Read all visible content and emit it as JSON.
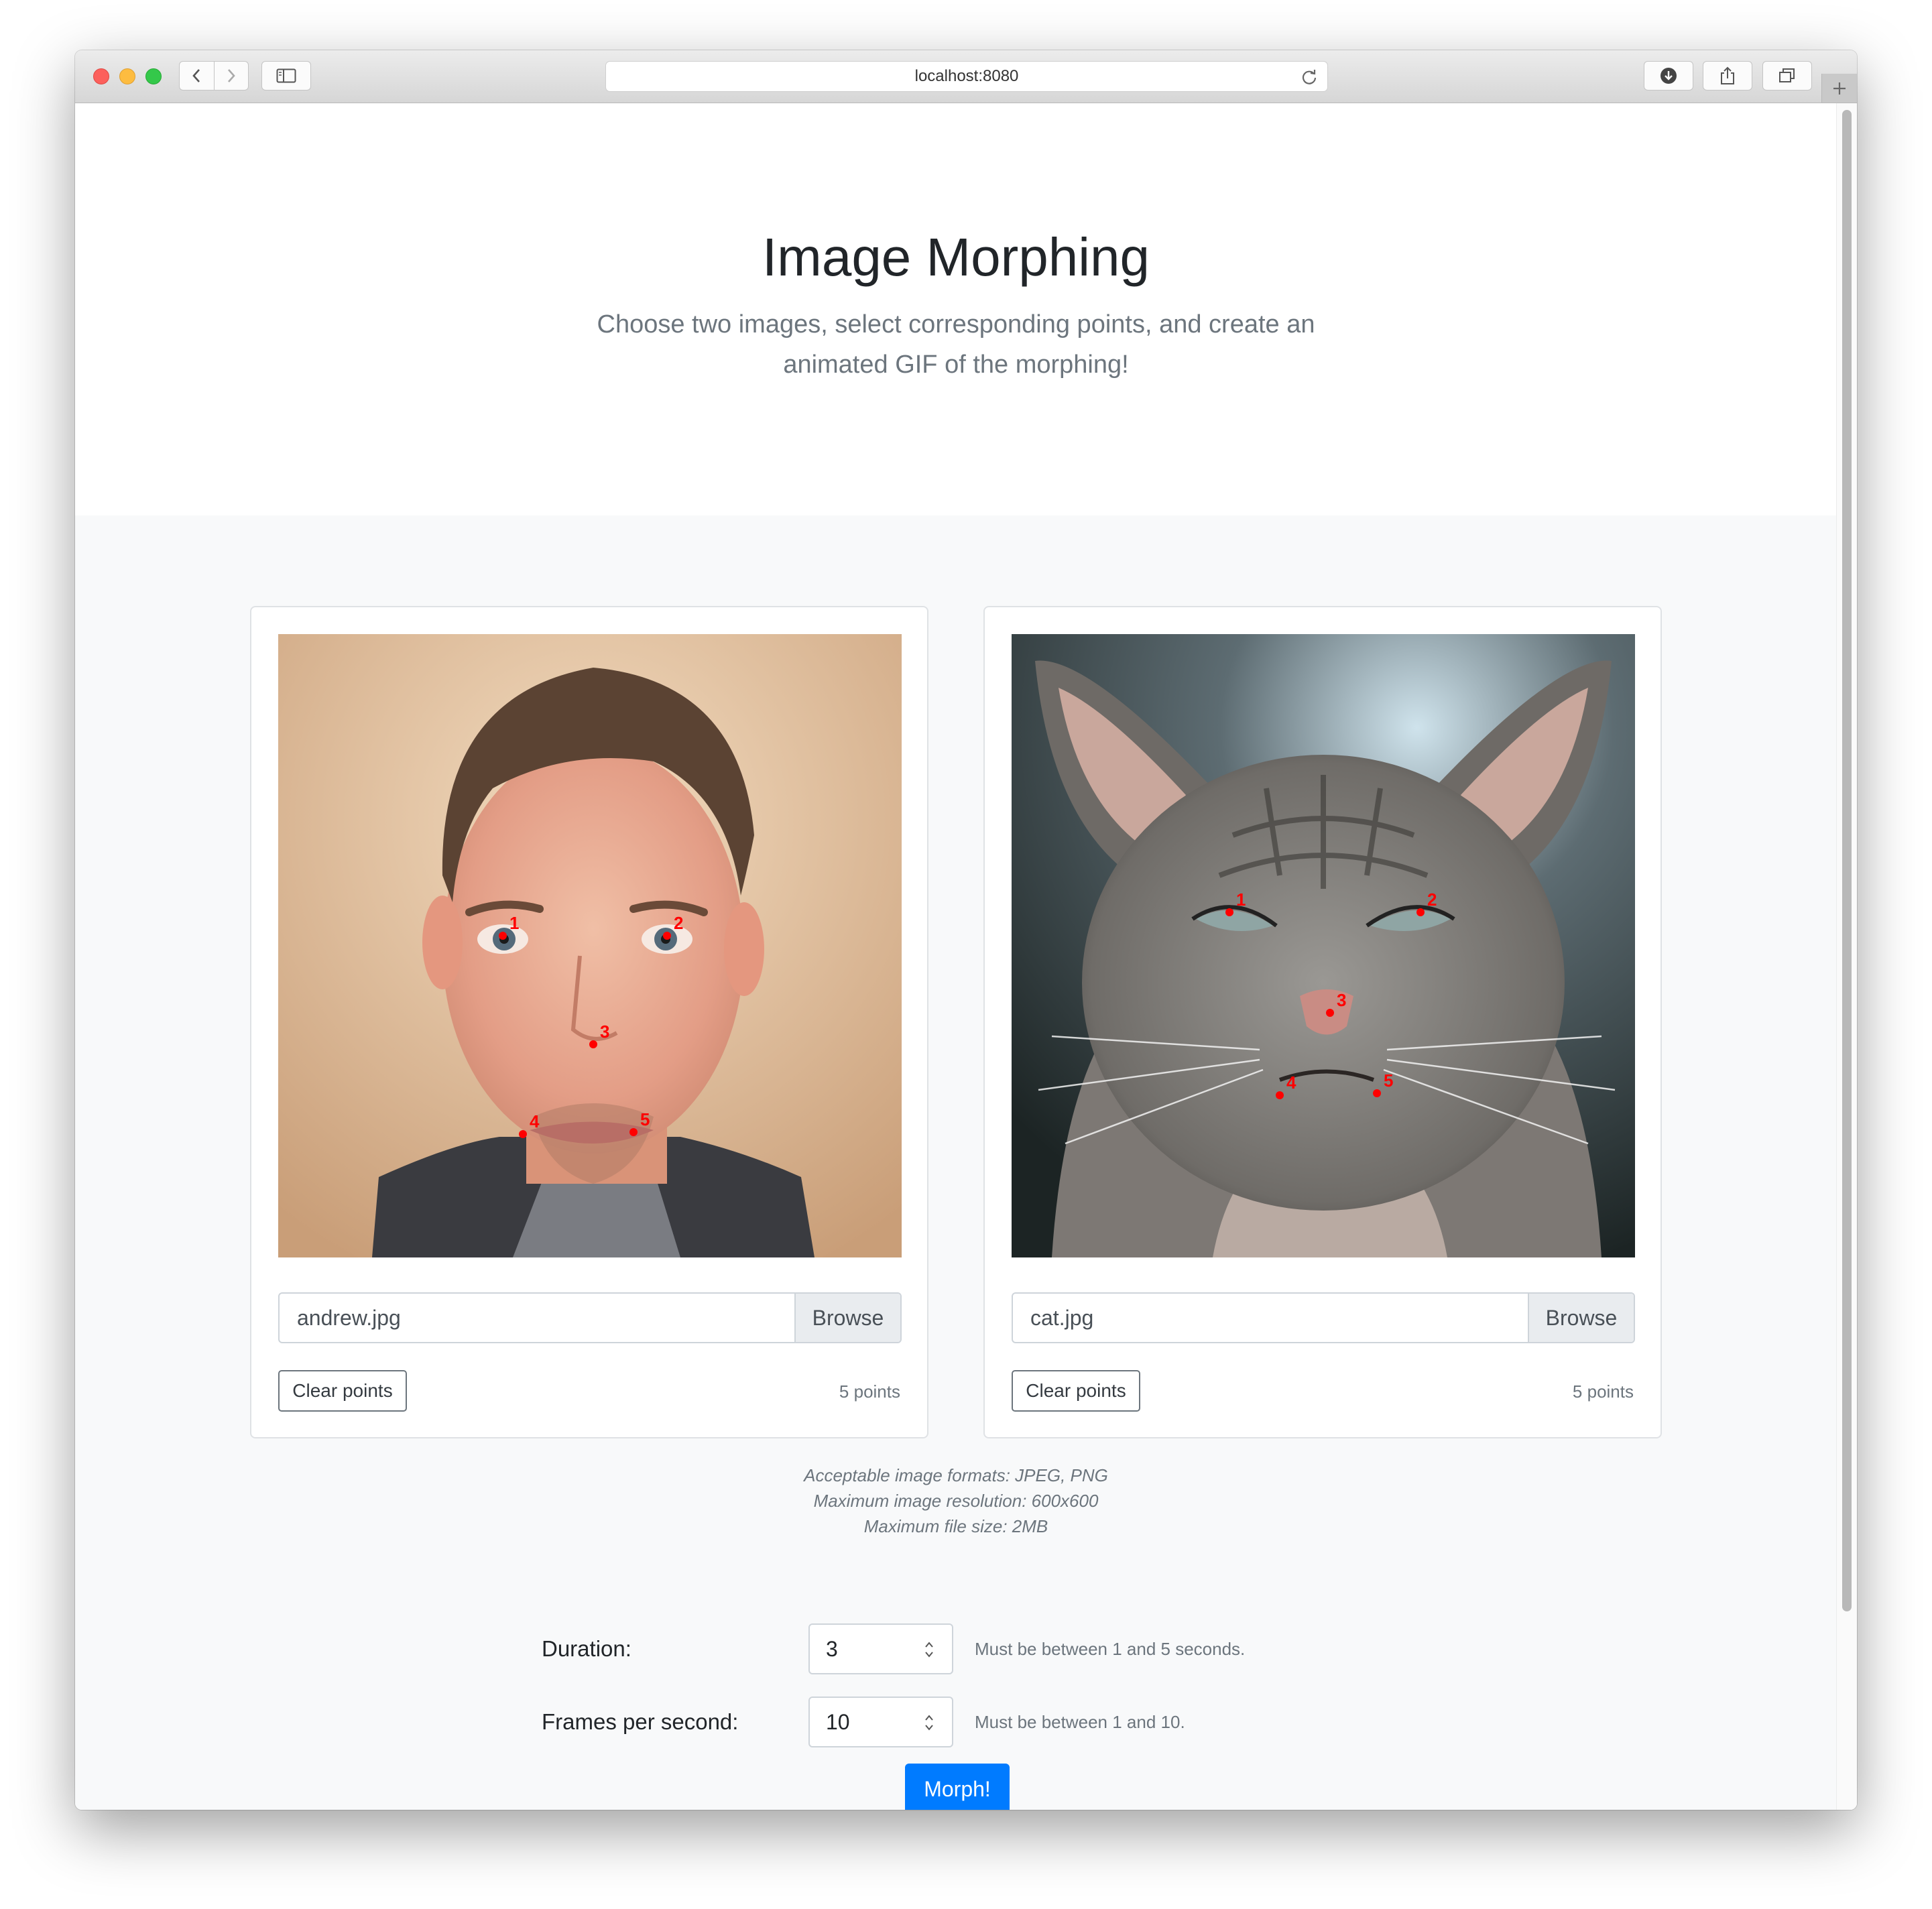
{
  "browser": {
    "url": "localhost:8080"
  },
  "header": {
    "title": "Image Morphing",
    "lead": "Choose two images, select corresponding points, and create an animated GIF of the morphing!"
  },
  "cards": [
    {
      "file_name": "andrew.jpg",
      "browse_label": "Browse",
      "clear_label": "Clear points",
      "point_count": "5 points",
      "point_labels": [
        "1",
        "2",
        "3",
        "4",
        "5"
      ]
    },
    {
      "file_name": "cat.jpg",
      "browse_label": "Browse",
      "clear_label": "Clear points",
      "point_count": "5 points",
      "point_labels": [
        "1",
        "2",
        "3",
        "4",
        "5"
      ]
    }
  ],
  "notes": {
    "formats": "Acceptable image formats: JPEG, PNG",
    "resolution": "Maximum image resolution: 600x600",
    "filesize": "Maximum file size: 2MB"
  },
  "form": {
    "duration_label": "Duration:",
    "duration_value": "3",
    "duration_help": "Must be between 1 and 5 seconds.",
    "fps_label": "Frames per second:",
    "fps_value": "10",
    "fps_help": "Must be between 1 and 10."
  },
  "morph_button": "Morph!",
  "colors": {
    "primary": "#007bff",
    "point_marker": "#ff0000",
    "muted_text": "#6c757d"
  }
}
